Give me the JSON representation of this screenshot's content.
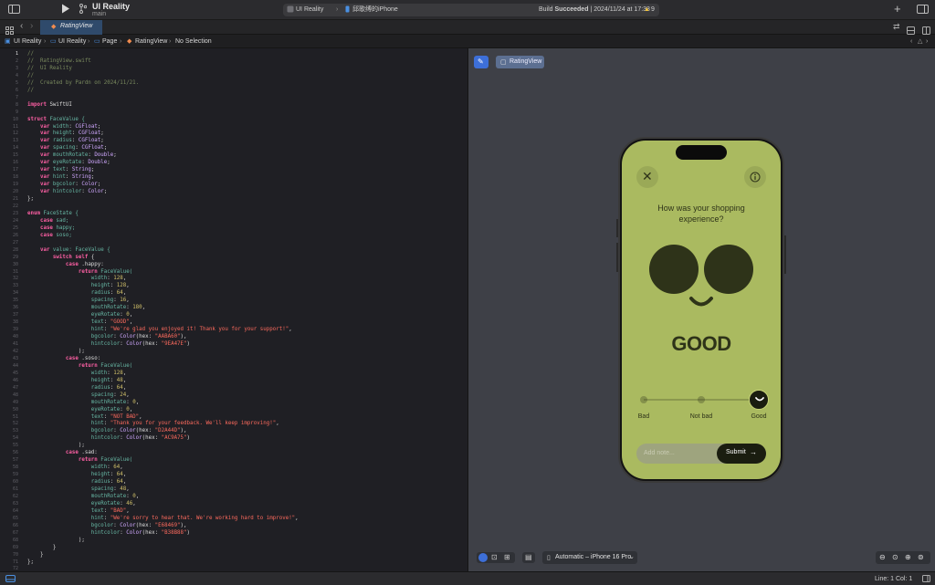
{
  "window": {
    "project_name": "UI Reality",
    "branch": "main",
    "scheme_app": "UI Reality",
    "scheme_device": "邱歌缚的iPhone",
    "build_status_prefix": "Build ",
    "build_status_bold": "Succeeded",
    "build_status_time": " | 2024/11/24 at 17:33",
    "warnings_count": "9"
  },
  "tab": {
    "label": "RatingView"
  },
  "breadcrumb": [
    "UI Reality",
    "UI Reality",
    "Page",
    "RatingView",
    "No Selection"
  ],
  "editor": {
    "lines": [
      [
        {
          "t": "//",
          "c": "cm"
        }
      ],
      [
        {
          "t": "//  RatingView.swift",
          "c": "cm"
        }
      ],
      [
        {
          "t": "//  UI Reality",
          "c": "cm"
        }
      ],
      [
        {
          "t": "//",
          "c": "cm"
        }
      ],
      [
        {
          "t": "//  Created by Pardn on 2024/11/21.",
          "c": "cm"
        }
      ],
      [
        {
          "t": "//",
          "c": "cm"
        }
      ],
      [],
      [
        {
          "t": "import",
          "c": "kw"
        },
        {
          "t": " SwiftUI",
          "c": ""
        }
      ],
      [],
      [
        {
          "t": "struct",
          "c": "kw"
        },
        {
          "t": " FaceValue {",
          "c": "prop"
        }
      ],
      [
        {
          "t": "    var",
          "c": "kw"
        },
        {
          "t": " width",
          "c": "prop"
        },
        {
          "t": ": ",
          "c": ""
        },
        {
          "t": "CGFloat",
          "c": "ty"
        },
        {
          "t": ";",
          "c": ""
        }
      ],
      [
        {
          "t": "    var",
          "c": "kw"
        },
        {
          "t": " height",
          "c": "prop"
        },
        {
          "t": ": ",
          "c": ""
        },
        {
          "t": "CGFloat",
          "c": "ty"
        },
        {
          "t": ";",
          "c": ""
        }
      ],
      [
        {
          "t": "    var",
          "c": "kw"
        },
        {
          "t": " radius",
          "c": "prop"
        },
        {
          "t": ": ",
          "c": ""
        },
        {
          "t": "CGFloat",
          "c": "ty"
        },
        {
          "t": ";",
          "c": ""
        }
      ],
      [
        {
          "t": "    var",
          "c": "kw"
        },
        {
          "t": " spacing",
          "c": "prop"
        },
        {
          "t": ": ",
          "c": ""
        },
        {
          "t": "CGFloat",
          "c": "ty"
        },
        {
          "t": ";",
          "c": ""
        }
      ],
      [
        {
          "t": "    var",
          "c": "kw"
        },
        {
          "t": " mouthRotate",
          "c": "prop"
        },
        {
          "t": ": ",
          "c": ""
        },
        {
          "t": "Double",
          "c": "ty"
        },
        {
          "t": ";",
          "c": ""
        }
      ],
      [
        {
          "t": "    var",
          "c": "kw"
        },
        {
          "t": " eyeRotate",
          "c": "prop"
        },
        {
          "t": ": ",
          "c": ""
        },
        {
          "t": "Double",
          "c": "ty"
        },
        {
          "t": ";",
          "c": ""
        }
      ],
      [
        {
          "t": "    var",
          "c": "kw"
        },
        {
          "t": " text",
          "c": "prop"
        },
        {
          "t": ": ",
          "c": ""
        },
        {
          "t": "String",
          "c": "ty"
        },
        {
          "t": ";",
          "c": ""
        }
      ],
      [
        {
          "t": "    var",
          "c": "kw"
        },
        {
          "t": " hint",
          "c": "prop"
        },
        {
          "t": ": ",
          "c": ""
        },
        {
          "t": "String",
          "c": "ty"
        },
        {
          "t": ";",
          "c": ""
        }
      ],
      [
        {
          "t": "    var",
          "c": "kw"
        },
        {
          "t": " bgcolor",
          "c": "prop"
        },
        {
          "t": ": ",
          "c": ""
        },
        {
          "t": "Color",
          "c": "ty"
        },
        {
          "t": ";",
          "c": ""
        }
      ],
      [
        {
          "t": "    var",
          "c": "kw"
        },
        {
          "t": " hintcolor",
          "c": "prop"
        },
        {
          "t": ": ",
          "c": ""
        },
        {
          "t": "Color",
          "c": "ty"
        },
        {
          "t": ";",
          "c": ""
        }
      ],
      [
        {
          "t": "};",
          "c": ""
        }
      ],
      [],
      [
        {
          "t": "enum",
          "c": "kw"
        },
        {
          "t": " FaceState {",
          "c": "prop"
        }
      ],
      [
        {
          "t": "    case",
          "c": "kw"
        },
        {
          "t": " sad;",
          "c": "prop"
        }
      ],
      [
        {
          "t": "    case",
          "c": "kw"
        },
        {
          "t": " happy;",
          "c": "prop"
        }
      ],
      [
        {
          "t": "    case",
          "c": "kw"
        },
        {
          "t": " soso;",
          "c": "prop"
        }
      ],
      [],
      [
        {
          "t": "    var",
          "c": "kw"
        },
        {
          "t": " value",
          "c": "prop"
        },
        {
          "t": ": FaceValue {",
          "c": "prop"
        }
      ],
      [
        {
          "t": "        switch",
          "c": "kw"
        },
        {
          "t": " self",
          "c": "kw"
        },
        {
          "t": " {",
          "c": ""
        }
      ],
      [
        {
          "t": "            case",
          "c": "kw"
        },
        {
          "t": " .happy:",
          "c": ""
        }
      ],
      [
        {
          "t": "                return",
          "c": "kw"
        },
        {
          "t": " FaceValue(",
          "c": "prop"
        }
      ],
      [
        {
          "t": "                    width",
          "c": "prop"
        },
        {
          "t": ": ",
          "c": ""
        },
        {
          "t": "128",
          "c": "num"
        },
        {
          "t": ",",
          "c": ""
        }
      ],
      [
        {
          "t": "                    height",
          "c": "prop"
        },
        {
          "t": ": ",
          "c": ""
        },
        {
          "t": "128",
          "c": "num"
        },
        {
          "t": ",",
          "c": ""
        }
      ],
      [
        {
          "t": "                    radius",
          "c": "prop"
        },
        {
          "t": ": ",
          "c": ""
        },
        {
          "t": "64",
          "c": "num"
        },
        {
          "t": ",",
          "c": ""
        }
      ],
      [
        {
          "t": "                    spacing",
          "c": "prop"
        },
        {
          "t": ": ",
          "c": ""
        },
        {
          "t": "16",
          "c": "num"
        },
        {
          "t": ",",
          "c": ""
        }
      ],
      [
        {
          "t": "                    mouthRotate",
          "c": "prop"
        },
        {
          "t": ": ",
          "c": ""
        },
        {
          "t": "180",
          "c": "num"
        },
        {
          "t": ",",
          "c": ""
        }
      ],
      [
        {
          "t": "                    eyeRotate",
          "c": "prop"
        },
        {
          "t": ": ",
          "c": ""
        },
        {
          "t": "0",
          "c": "num"
        },
        {
          "t": ",",
          "c": ""
        }
      ],
      [
        {
          "t": "                    text",
          "c": "prop"
        },
        {
          "t": ": ",
          "c": ""
        },
        {
          "t": "\"GOOD\"",
          "c": "str"
        },
        {
          "t": ",",
          "c": ""
        }
      ],
      [
        {
          "t": "                    hint",
          "c": "prop"
        },
        {
          "t": ": ",
          "c": ""
        },
        {
          "t": "\"We're glad you enjoyed it! Thank you for your support!\"",
          "c": "str"
        },
        {
          "t": ",",
          "c": ""
        }
      ],
      [
        {
          "t": "                    bgcolor",
          "c": "prop"
        },
        {
          "t": ": ",
          "c": ""
        },
        {
          "t": "Color",
          "c": "ty"
        },
        {
          "t": "(hex: ",
          "c": ""
        },
        {
          "t": "\"AABA60\"",
          "c": "str"
        },
        {
          "t": "),",
          "c": ""
        }
      ],
      [
        {
          "t": "                    hintcolor",
          "c": "prop"
        },
        {
          "t": ": ",
          "c": ""
        },
        {
          "t": "Color",
          "c": "ty"
        },
        {
          "t": "(hex: ",
          "c": ""
        },
        {
          "t": "\"9EA47E\"",
          "c": "str"
        },
        {
          "t": ")",
          "c": ""
        }
      ],
      [
        {
          "t": "                );",
          "c": ""
        }
      ],
      [
        {
          "t": "            case",
          "c": "kw"
        },
        {
          "t": " .soso:",
          "c": ""
        }
      ],
      [
        {
          "t": "                return",
          "c": "kw"
        },
        {
          "t": " FaceValue(",
          "c": "prop"
        }
      ],
      [
        {
          "t": "                    width",
          "c": "prop"
        },
        {
          "t": ": ",
          "c": ""
        },
        {
          "t": "128",
          "c": "num"
        },
        {
          "t": ",",
          "c": ""
        }
      ],
      [
        {
          "t": "                    height",
          "c": "prop"
        },
        {
          "t": ": ",
          "c": ""
        },
        {
          "t": "48",
          "c": "num"
        },
        {
          "t": ",",
          "c": ""
        }
      ],
      [
        {
          "t": "                    radius",
          "c": "prop"
        },
        {
          "t": ": ",
          "c": ""
        },
        {
          "t": "64",
          "c": "num"
        },
        {
          "t": ",",
          "c": ""
        }
      ],
      [
        {
          "t": "                    spacing",
          "c": "prop"
        },
        {
          "t": ": ",
          "c": ""
        },
        {
          "t": "24",
          "c": "num"
        },
        {
          "t": ",",
          "c": ""
        }
      ],
      [
        {
          "t": "                    mouthRotate",
          "c": "prop"
        },
        {
          "t": ": ",
          "c": ""
        },
        {
          "t": "0",
          "c": "num"
        },
        {
          "t": ",",
          "c": ""
        }
      ],
      [
        {
          "t": "                    eyeRotate",
          "c": "prop"
        },
        {
          "t": ": ",
          "c": ""
        },
        {
          "t": "0",
          "c": "num"
        },
        {
          "t": ",",
          "c": ""
        }
      ],
      [
        {
          "t": "                    text",
          "c": "prop"
        },
        {
          "t": ": ",
          "c": ""
        },
        {
          "t": "\"NOT BAD\"",
          "c": "str"
        },
        {
          "t": ",",
          "c": ""
        }
      ],
      [
        {
          "t": "                    hint",
          "c": "prop"
        },
        {
          "t": ": ",
          "c": ""
        },
        {
          "t": "\"Thank you for your feedback. We'll keep improving!\"",
          "c": "str"
        },
        {
          "t": ",",
          "c": ""
        }
      ],
      [
        {
          "t": "                    bgcolor",
          "c": "prop"
        },
        {
          "t": ": ",
          "c": ""
        },
        {
          "t": "Color",
          "c": "ty"
        },
        {
          "t": "(hex: ",
          "c": ""
        },
        {
          "t": "\"D2A44D\"",
          "c": "str"
        },
        {
          "t": "),",
          "c": ""
        }
      ],
      [
        {
          "t": "                    hintcolor",
          "c": "prop"
        },
        {
          "t": ": ",
          "c": ""
        },
        {
          "t": "Color",
          "c": "ty"
        },
        {
          "t": "(hex: ",
          "c": ""
        },
        {
          "t": "\"AC9A75\"",
          "c": "str"
        },
        {
          "t": ")",
          "c": ""
        }
      ],
      [
        {
          "t": "                );",
          "c": ""
        }
      ],
      [
        {
          "t": "            case",
          "c": "kw"
        },
        {
          "t": " .sad:",
          "c": ""
        }
      ],
      [
        {
          "t": "                return",
          "c": "kw"
        },
        {
          "t": " FaceValue(",
          "c": "prop"
        }
      ],
      [
        {
          "t": "                    width",
          "c": "prop"
        },
        {
          "t": ": ",
          "c": ""
        },
        {
          "t": "64",
          "c": "num"
        },
        {
          "t": ",",
          "c": ""
        }
      ],
      [
        {
          "t": "                    height",
          "c": "prop"
        },
        {
          "t": ": ",
          "c": ""
        },
        {
          "t": "64",
          "c": "num"
        },
        {
          "t": ",",
          "c": ""
        }
      ],
      [
        {
          "t": "                    radius",
          "c": "prop"
        },
        {
          "t": ": ",
          "c": ""
        },
        {
          "t": "64",
          "c": "num"
        },
        {
          "t": ",",
          "c": ""
        }
      ],
      [
        {
          "t": "                    spacing",
          "c": "prop"
        },
        {
          "t": ": ",
          "c": ""
        },
        {
          "t": "48",
          "c": "num"
        },
        {
          "t": ",",
          "c": ""
        }
      ],
      [
        {
          "t": "                    mouthRotate",
          "c": "prop"
        },
        {
          "t": ": ",
          "c": ""
        },
        {
          "t": "0",
          "c": "num"
        },
        {
          "t": ",",
          "c": ""
        }
      ],
      [
        {
          "t": "                    eyeRotate",
          "c": "prop"
        },
        {
          "t": ": ",
          "c": ""
        },
        {
          "t": "46",
          "c": "num"
        },
        {
          "t": ",",
          "c": ""
        }
      ],
      [
        {
          "t": "                    text",
          "c": "prop"
        },
        {
          "t": ": ",
          "c": ""
        },
        {
          "t": "\"BAD\"",
          "c": "str"
        },
        {
          "t": ",",
          "c": ""
        }
      ],
      [
        {
          "t": "                    hint",
          "c": "prop"
        },
        {
          "t": ": ",
          "c": ""
        },
        {
          "t": "\"We're sorry to hear that. We're working hard to improve!\"",
          "c": "str"
        },
        {
          "t": ",",
          "c": ""
        }
      ],
      [
        {
          "t": "                    bgcolor",
          "c": "prop"
        },
        {
          "t": ": ",
          "c": ""
        },
        {
          "t": "Color",
          "c": "ty"
        },
        {
          "t": "(hex: ",
          "c": ""
        },
        {
          "t": "\"E68469\"",
          "c": "str"
        },
        {
          "t": "),",
          "c": ""
        }
      ],
      [
        {
          "t": "                    hintcolor",
          "c": "prop"
        },
        {
          "t": ": ",
          "c": ""
        },
        {
          "t": "Color",
          "c": "ty"
        },
        {
          "t": "(hex: ",
          "c": ""
        },
        {
          "t": "\"B38B88\"",
          "c": "str"
        },
        {
          "t": ")",
          "c": ""
        }
      ],
      [
        {
          "t": "                );",
          "c": ""
        }
      ],
      [
        {
          "t": "        }",
          "c": ""
        }
      ],
      [
        {
          "t": "    }",
          "c": ""
        }
      ],
      [
        {
          "t": "};",
          "c": ""
        }
      ],
      [],
      []
    ]
  },
  "preview": {
    "pin_icon": "pin-icon",
    "view_chip": "RatingView",
    "device_selector": "Automatic – iPhone 16 Pro",
    "app": {
      "question": "How was your shopping experience?",
      "rating_text": "GOOD",
      "scale_labels": [
        "Bad",
        "Not bad",
        "Good"
      ],
      "selected_index": 2,
      "note_placeholder": "Add note...",
      "submit_label": "Submit",
      "bg_color": "#AABA60",
      "ink_color": "#2E3319",
      "hint_color": "#9EA47E"
    }
  },
  "status": {
    "cursor_position": "Line: 1  Col: 1"
  }
}
